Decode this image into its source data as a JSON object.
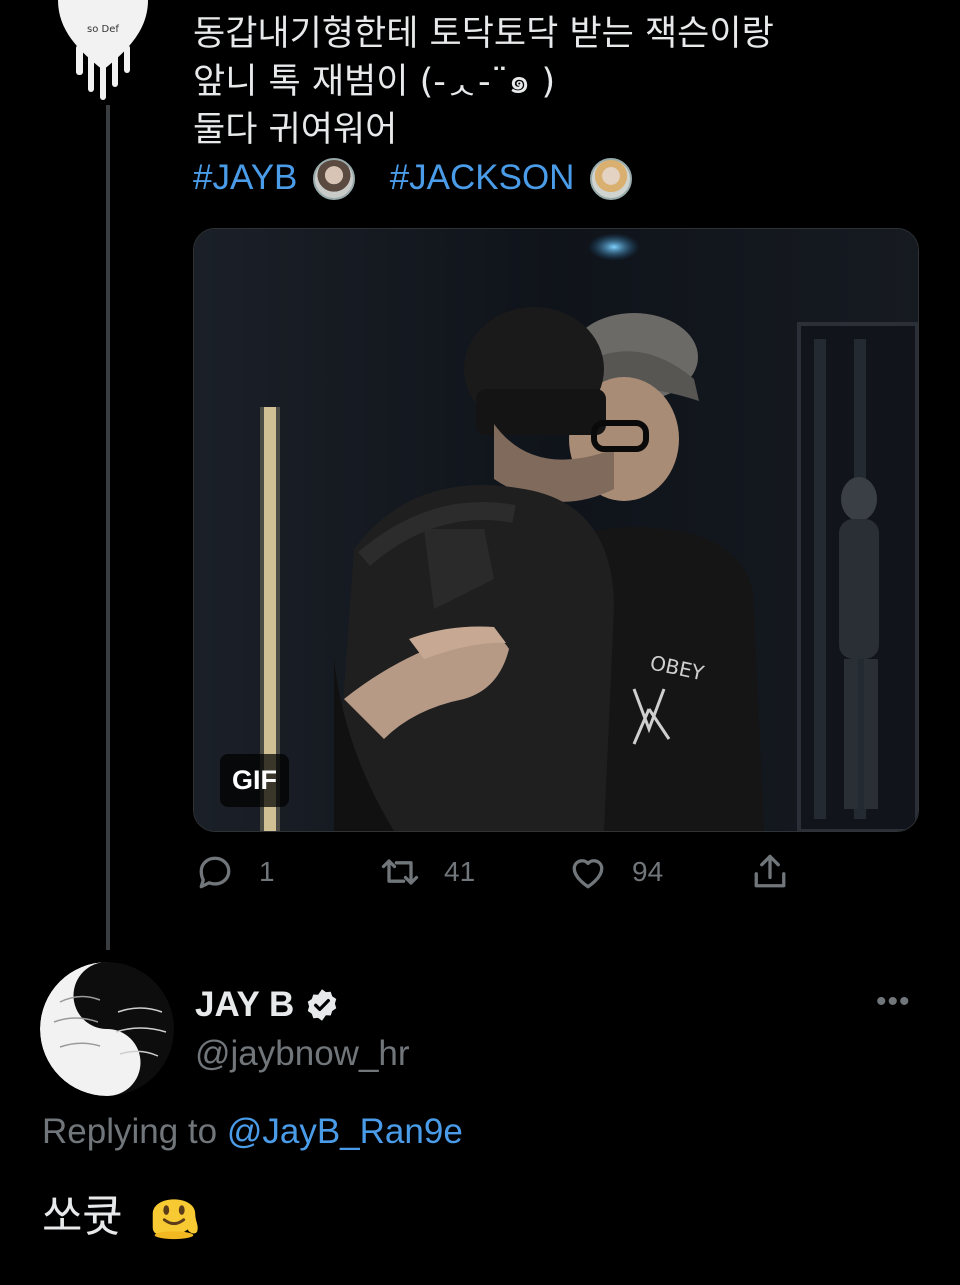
{
  "tweet": {
    "lines": [
      "동갑내기형한테 토닥토닥 받는 잭슨이랑",
      "앞니 톡 재범이 (-ᆺ-¨๑ )",
      "둘다 귀여워어"
    ],
    "hashtags": [
      "#JAYB",
      "#JACKSON"
    ],
    "media_badge": "GIF",
    "counts": {
      "reply": "1",
      "retweet": "41",
      "like": "94"
    }
  },
  "reply": {
    "author_name": "JAY B",
    "handle": "@jaybnow_hr",
    "more_label": "•••",
    "replying_prefix": "Replying to",
    "replying_mention": "@JayB_Ran9e",
    "text": "쏘큣"
  },
  "colors": {
    "background": "#000000",
    "text": "#e7e9ea",
    "muted": "#71767b",
    "link": "#4a9be8"
  },
  "icons": {
    "reply": "comment-icon",
    "retweet": "retweet-icon",
    "like": "heart-icon",
    "share": "share-icon",
    "verified": "verified-badge-icon",
    "emoji": "melting-face-emoji"
  }
}
